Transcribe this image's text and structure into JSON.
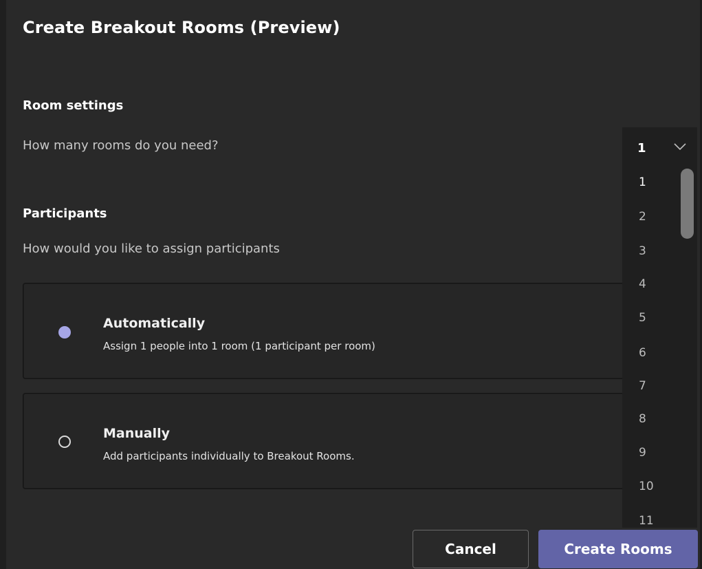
{
  "dialog": {
    "title": "Create Breakout Rooms (Preview)"
  },
  "room_settings": {
    "heading": "Room settings",
    "prompt": "How many rooms do you need?"
  },
  "participants": {
    "heading": "Participants",
    "prompt": "How would you like to assign participants",
    "options": [
      {
        "title": "Automatically",
        "description": "Assign 1 people into 1 room (1 participant per room)",
        "selected": true
      },
      {
        "title": "Manually",
        "description": "Add participants individually to Breakout Rooms.",
        "selected": false
      }
    ]
  },
  "rooms_dropdown": {
    "selected_value": "1",
    "options": [
      "1",
      "2",
      "3",
      "4",
      "5",
      "6",
      "7",
      "8",
      "9",
      "10",
      "11"
    ]
  },
  "buttons": {
    "cancel": "Cancel",
    "create": "Create Rooms"
  },
  "colors": {
    "background": "#292929",
    "accent": "#6264a7",
    "radio_selected": "#a6a6e6"
  }
}
